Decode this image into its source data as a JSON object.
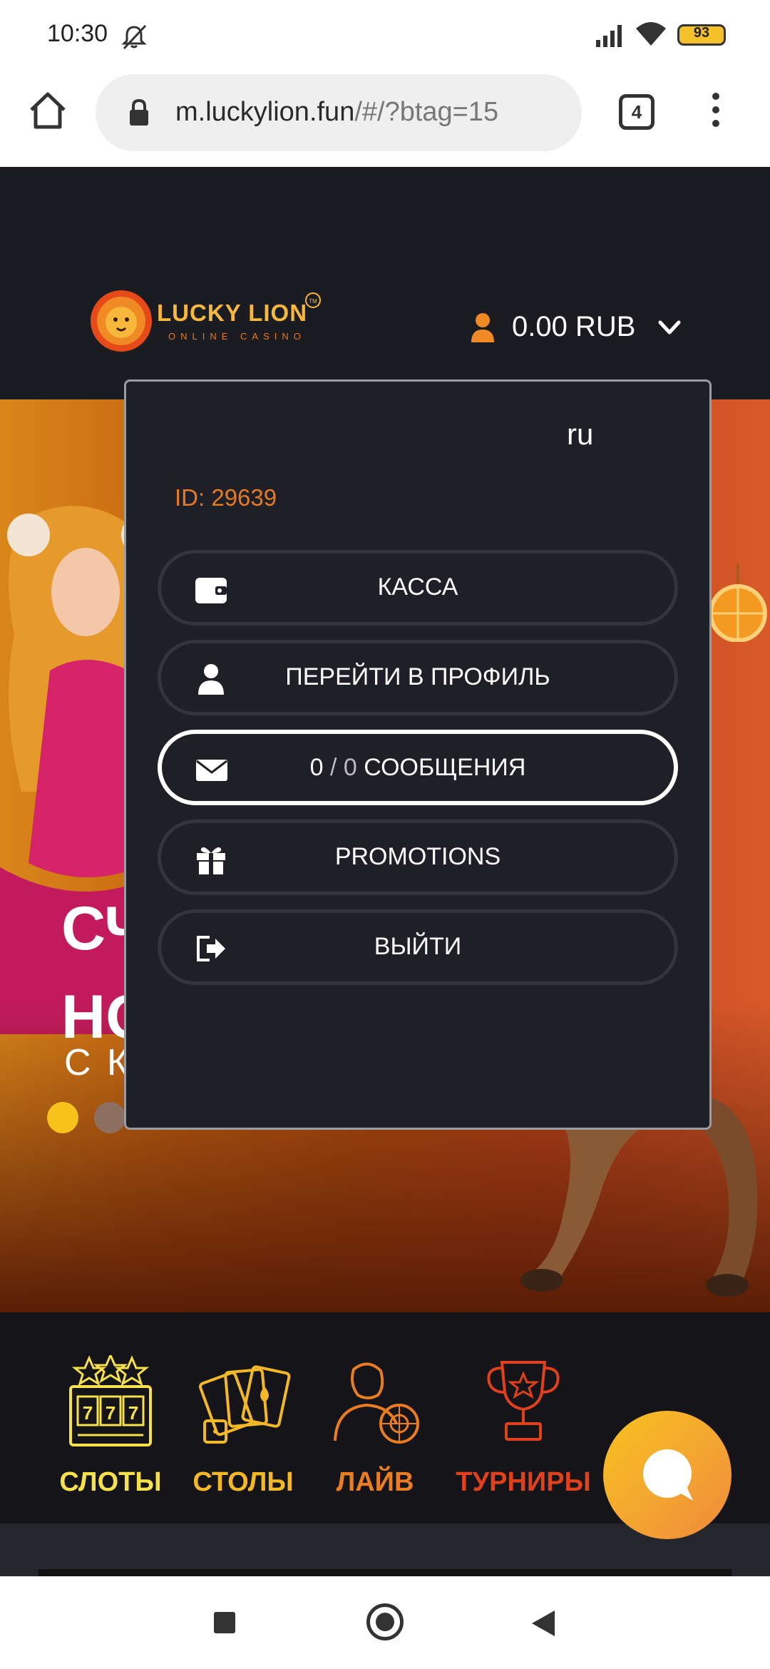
{
  "status_bar": {
    "time": "10:30",
    "battery": "93",
    "icons": [
      "bell-off-icon",
      "signal-icon",
      "wifi-icon",
      "battery-icon"
    ]
  },
  "browser": {
    "url_main": "m.luckylion.fun",
    "url_rest": "/#/?btag=15",
    "tab_count": "4",
    "icons": [
      "home-icon",
      "lock-icon",
      "tabs-icon",
      "menu-icon"
    ]
  },
  "site": {
    "logo_text": "LUCKY LION",
    "logo_sub": "ONLINE CASINO",
    "logo_tm": "TM",
    "balance": "0.00 RUB"
  },
  "hero": {
    "title_line1": "СЧ",
    "title_line2": "НО",
    "subtitle": "С К",
    "slider_dots": 2,
    "active_dot": 0
  },
  "dropdown": {
    "email_suffix": "ru",
    "user_id": "ID: 29639",
    "buttons": [
      {
        "label": "КАССА",
        "icon": "wallet-icon"
      },
      {
        "label": "ПЕРЕЙТИ В ПРОФИЛЬ",
        "icon": "user-icon"
      },
      {
        "label_prefix": "0",
        "label_sep": "/",
        "label_count": "0",
        "label_text": "СООБЩЕНИЯ",
        "icon": "envelope-icon"
      },
      {
        "label": "PROMOTIONS",
        "icon": "gift-icon"
      },
      {
        "label": "ВЫЙТИ",
        "icon": "logout-icon"
      }
    ]
  },
  "categories": [
    {
      "label": "СЛОТЫ",
      "color": "#f7e14a",
      "icon": "slots-icon"
    },
    {
      "label": "СТОЛЫ",
      "color": "#f2b825",
      "icon": "cards-icon"
    },
    {
      "label": "ЛАЙВ",
      "color": "#ea7d22",
      "icon": "live-dealer-icon"
    },
    {
      "label": "ТУРНИРЫ",
      "color": "#e0401c",
      "icon": "trophy-icon"
    }
  ],
  "colors": {
    "accent": "#e67a23",
    "header_bg": "#1b1b22",
    "dropdown_bg": "#1f2027"
  }
}
